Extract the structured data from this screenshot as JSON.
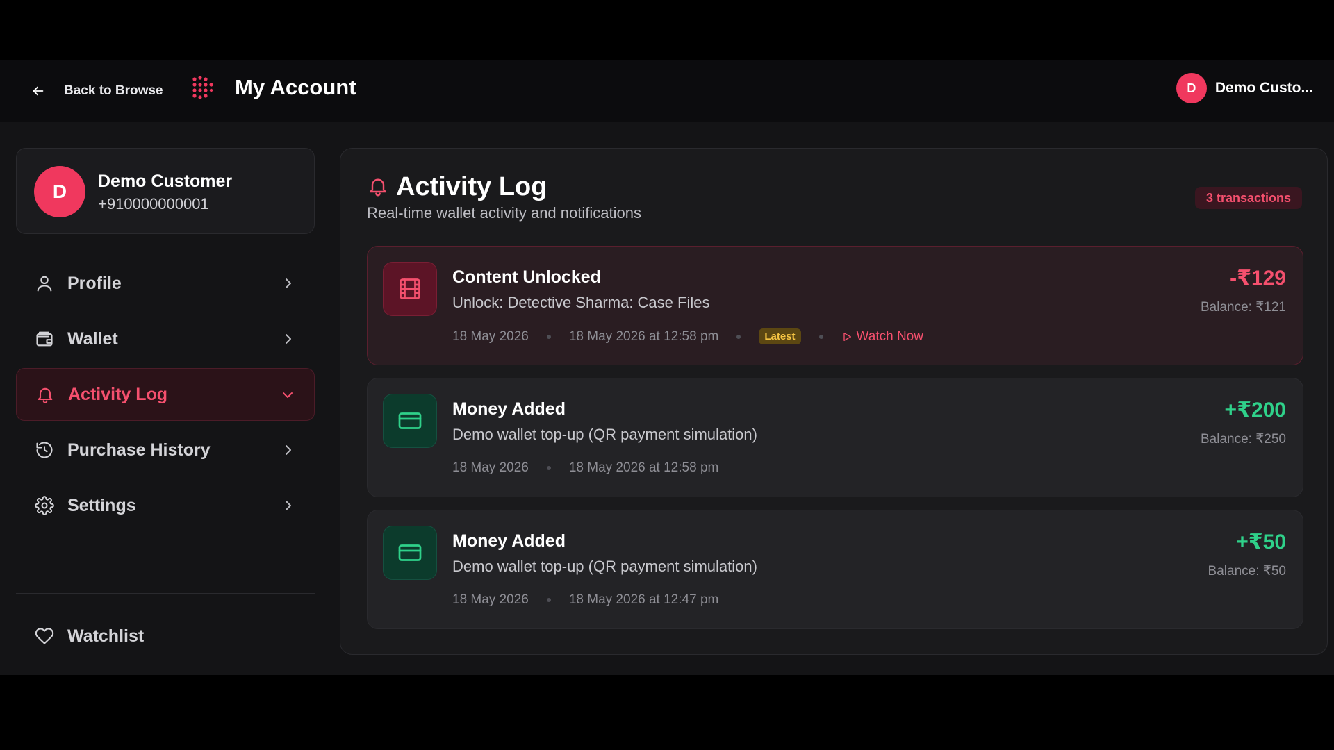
{
  "header": {
    "back_label": "Back to Browse",
    "title": "My Account",
    "user_initial": "D",
    "user_name": "Demo Custo..."
  },
  "sidebar": {
    "profile": {
      "initial": "D",
      "name": "Demo Customer",
      "phone": "+910000000001"
    },
    "items": [
      {
        "label": "Profile",
        "icon": "user-icon",
        "active": false
      },
      {
        "label": "Wallet",
        "icon": "wallet-icon",
        "active": false
      },
      {
        "label": "Activity Log",
        "icon": "bell-icon",
        "active": true
      },
      {
        "label": "Purchase History",
        "icon": "history-icon",
        "active": false
      },
      {
        "label": "Settings",
        "icon": "gear-icon",
        "active": false
      }
    ],
    "watchlist": {
      "label": "Watchlist",
      "icon": "heart-icon"
    }
  },
  "activity": {
    "title": "Activity Log",
    "subtitle": "Real-time wallet activity and notifications",
    "count_badge": "3 transactions",
    "entries": [
      {
        "title": "Content Unlocked",
        "description": "Unlock: Detective Sharma: Case Files",
        "date": "18 May 2026",
        "datetime": "18 May 2026 at 12:58 pm",
        "tag": "Latest",
        "action": "Watch Now",
        "amount": "-₹129",
        "balance": "Balance: ₹121",
        "icon": "film-icon"
      },
      {
        "title": "Money Added",
        "description": "Demo wallet top-up (QR payment simulation)",
        "date": "18 May 2026",
        "datetime": "18 May 2026 at 12:58 pm",
        "amount": "+₹200",
        "balance": "Balance: ₹250",
        "icon": "card-icon"
      },
      {
        "title": "Money Added",
        "description": "Demo wallet top-up (QR payment simulation)",
        "date": "18 May 2026",
        "datetime": "18 May 2026 at 12:47 pm",
        "amount": "+₹50",
        "balance": "Balance: ₹50",
        "icon": "card-icon"
      }
    ]
  },
  "colors": {
    "accent": "#f5506e",
    "positive": "#2fd18a",
    "background": "#141416"
  }
}
